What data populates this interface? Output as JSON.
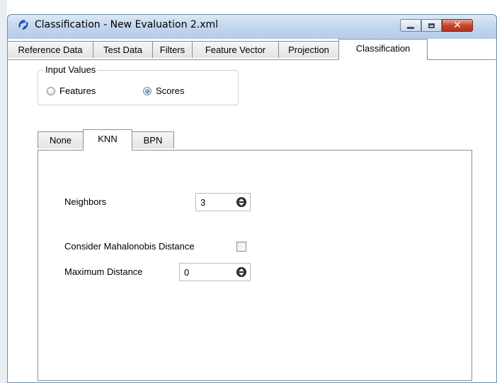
{
  "window": {
    "title": "Classification - New Evaluation 2.xml",
    "icon": "app-logo-icon"
  },
  "titlebar_buttons": {
    "minimize": "minimize-icon",
    "maximize": "maximize-icon",
    "close": "close-icon",
    "close_glyph": "✕"
  },
  "tabs": [
    {
      "label": "Reference Data"
    },
    {
      "label": "Test Data"
    },
    {
      "label": "Filters"
    },
    {
      "label": "Feature Vector"
    },
    {
      "label": "Projection"
    },
    {
      "label": "Classification",
      "active": true
    }
  ],
  "input_values": {
    "legend": "Input Values",
    "options": [
      {
        "label": "Features",
        "selected": false
      },
      {
        "label": "Scores",
        "selected": true
      }
    ]
  },
  "classifier_tabs": [
    {
      "label": "None"
    },
    {
      "label": "KNN",
      "active": true
    },
    {
      "label": "BPN"
    }
  ],
  "knn": {
    "neighbors_label": "Neighbors",
    "neighbors_value": "3",
    "mahalanobis_label": "Consider Mahalonobis Distance",
    "mahalanobis_checked": false,
    "max_distance_label": "Maximum Distance",
    "max_distance_value": "0"
  },
  "colors": {
    "titlebar": "#c3d6ee",
    "close_button": "#c9452d",
    "radio_selected": "#1663b5"
  }
}
